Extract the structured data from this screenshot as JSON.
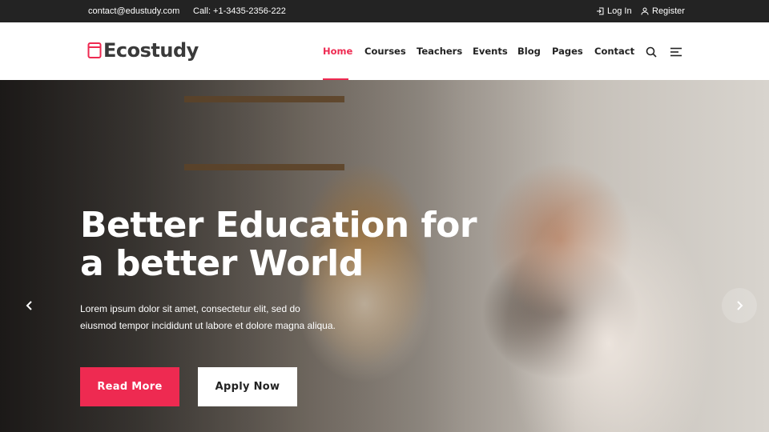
{
  "topbar": {
    "email": "contact@edustudy.com",
    "phone": "Call: +1-3435-2356-222",
    "login": "Log In",
    "register": "Register"
  },
  "header": {
    "logo": "Ecostudy",
    "nav": [
      {
        "label": "Home",
        "active": true
      },
      {
        "label": "Courses",
        "active": false
      },
      {
        "label": "Teachers",
        "active": false
      },
      {
        "label": "Events",
        "active": false
      },
      {
        "label": "Blog",
        "active": false
      },
      {
        "label": "Pages",
        "active": false
      },
      {
        "label": "Contact",
        "active": false
      }
    ],
    "icons": [
      "search-icon",
      "menu-icon"
    ]
  },
  "hero": {
    "title_line1": "Better Education for",
    "title_line2": "a better World",
    "description_line1": "Lorem ipsum dolor sit amet, consectetur elit, sed do",
    "description_line2": "eiusmod tempor incididunt ut labore et dolore magna aliqua.",
    "primary_button": "Read More",
    "secondary_button": "Apply Now",
    "prev_icon": "chevron-left-icon",
    "next_icon": "chevron-right-icon"
  },
  "colors": {
    "accent": "#ee2a51",
    "topbar_bg": "#232323",
    "text_dark": "#222222"
  }
}
